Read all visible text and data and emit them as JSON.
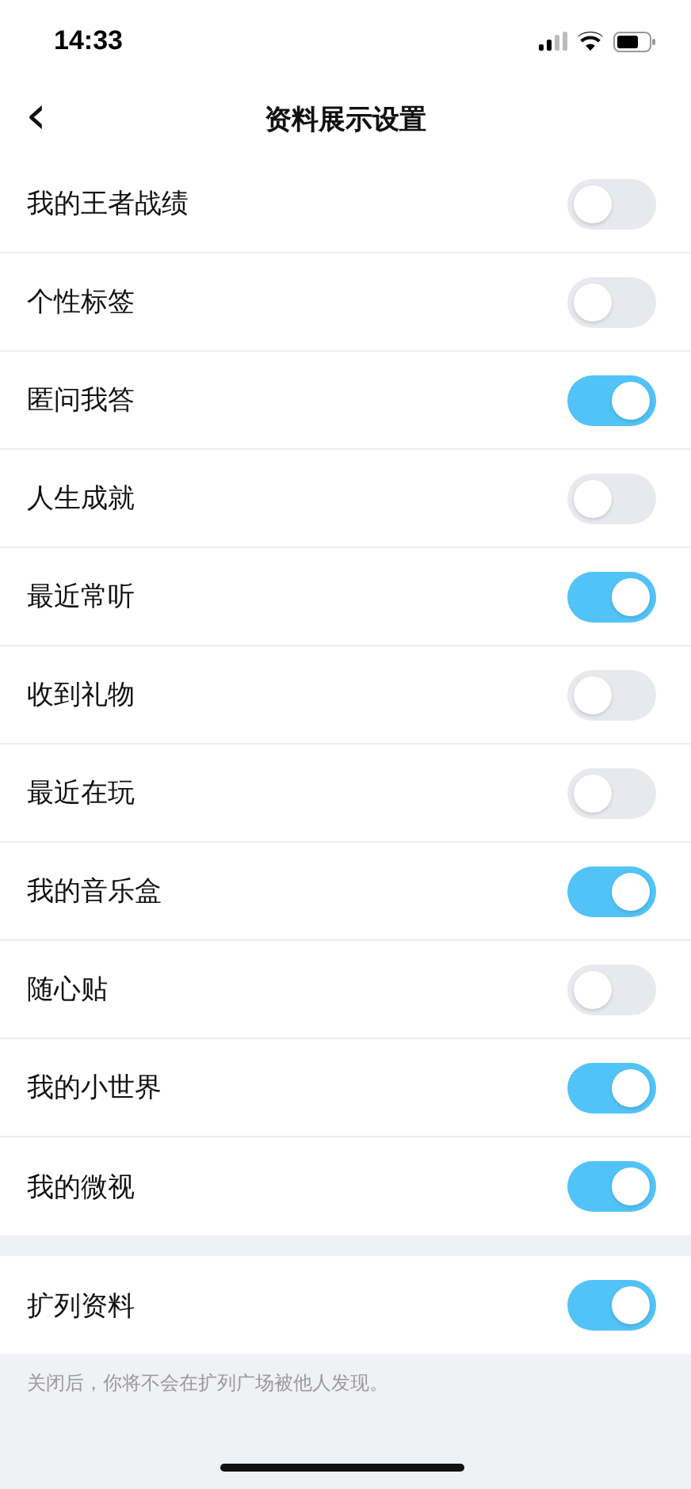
{
  "status_bar": {
    "time": "14:33"
  },
  "nav": {
    "back": "‹",
    "title": "资料展示设置"
  },
  "settings": [
    {
      "label": "我的王者战绩",
      "on": false
    },
    {
      "label": "个性标签",
      "on": false
    },
    {
      "label": "匿问我答",
      "on": true
    },
    {
      "label": "人生成就",
      "on": false
    },
    {
      "label": "最近常听",
      "on": true
    },
    {
      "label": "收到礼物",
      "on": false
    },
    {
      "label": "最近在玩",
      "on": false
    },
    {
      "label": "我的音乐盒",
      "on": true
    },
    {
      "label": "随心贴",
      "on": false
    },
    {
      "label": "我的小世界",
      "on": true
    },
    {
      "label": "我的微视",
      "on": true
    }
  ],
  "extra": {
    "label": "扩列资料",
    "on": true
  },
  "footnote": "关闭后，你将不会在扩列广场被他人发现。"
}
